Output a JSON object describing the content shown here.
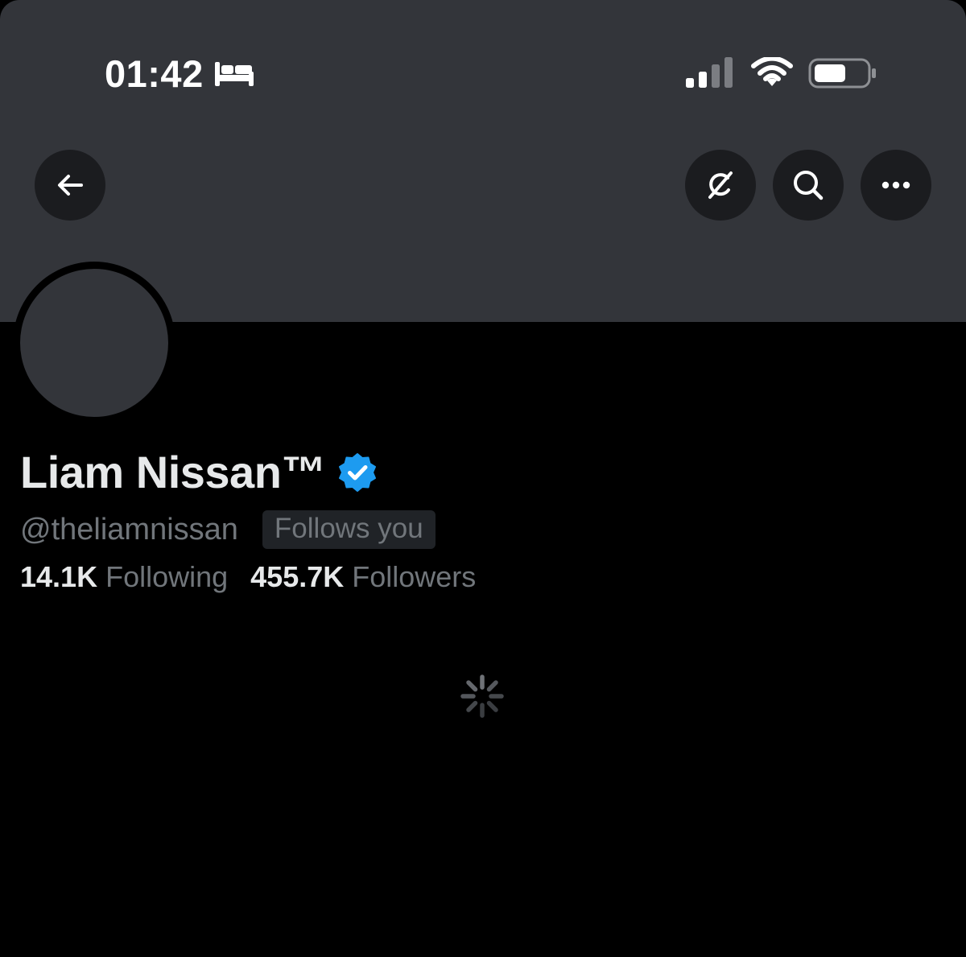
{
  "status_bar": {
    "time": "01:42",
    "sleep_icon": "bed-icon",
    "signal_icon": "cellular-signal-icon",
    "wifi_icon": "wifi-icon",
    "battery_icon": "battery-icon"
  },
  "nav": {
    "back_icon": "arrow-left-icon",
    "grok_icon": "grok-icon",
    "search_icon": "search-icon",
    "more_icon": "ellipsis-icon"
  },
  "profile": {
    "display_name": "Liam Nissan™",
    "verified_icon": "verified-badge-icon",
    "handle": "@theliamnissan",
    "follows_you": "Follows you",
    "following_count": "14.1K",
    "following_label": "Following",
    "followers_count": "455.7K",
    "followers_label": "Followers"
  },
  "loading_icon": "loading-spinner-icon",
  "colors": {
    "banner": "#33353a",
    "background": "#000000",
    "verified": "#1d9bf0",
    "secondary_text": "#71767b",
    "primary_text": "#e7e9ea"
  }
}
